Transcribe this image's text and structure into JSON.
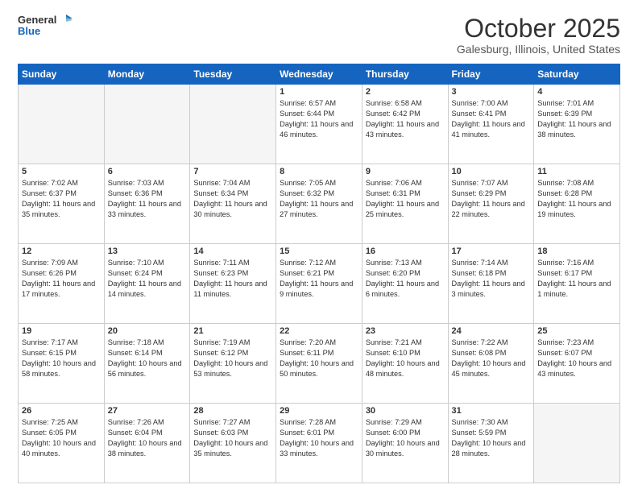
{
  "header": {
    "logo_general": "General",
    "logo_blue": "Blue",
    "title": "October 2025",
    "subtitle": "Galesburg, Illinois, United States"
  },
  "days_of_week": [
    "Sunday",
    "Monday",
    "Tuesday",
    "Wednesday",
    "Thursday",
    "Friday",
    "Saturday"
  ],
  "weeks": [
    [
      {
        "day": "",
        "info": ""
      },
      {
        "day": "",
        "info": ""
      },
      {
        "day": "",
        "info": ""
      },
      {
        "day": "1",
        "info": "Sunrise: 6:57 AM\nSunset: 6:44 PM\nDaylight: 11 hours\nand 46 minutes."
      },
      {
        "day": "2",
        "info": "Sunrise: 6:58 AM\nSunset: 6:42 PM\nDaylight: 11 hours\nand 43 minutes."
      },
      {
        "day": "3",
        "info": "Sunrise: 7:00 AM\nSunset: 6:41 PM\nDaylight: 11 hours\nand 41 minutes."
      },
      {
        "day": "4",
        "info": "Sunrise: 7:01 AM\nSunset: 6:39 PM\nDaylight: 11 hours\nand 38 minutes."
      }
    ],
    [
      {
        "day": "5",
        "info": "Sunrise: 7:02 AM\nSunset: 6:37 PM\nDaylight: 11 hours\nand 35 minutes."
      },
      {
        "day": "6",
        "info": "Sunrise: 7:03 AM\nSunset: 6:36 PM\nDaylight: 11 hours\nand 33 minutes."
      },
      {
        "day": "7",
        "info": "Sunrise: 7:04 AM\nSunset: 6:34 PM\nDaylight: 11 hours\nand 30 minutes."
      },
      {
        "day": "8",
        "info": "Sunrise: 7:05 AM\nSunset: 6:32 PM\nDaylight: 11 hours\nand 27 minutes."
      },
      {
        "day": "9",
        "info": "Sunrise: 7:06 AM\nSunset: 6:31 PM\nDaylight: 11 hours\nand 25 minutes."
      },
      {
        "day": "10",
        "info": "Sunrise: 7:07 AM\nSunset: 6:29 PM\nDaylight: 11 hours\nand 22 minutes."
      },
      {
        "day": "11",
        "info": "Sunrise: 7:08 AM\nSunset: 6:28 PM\nDaylight: 11 hours\nand 19 minutes."
      }
    ],
    [
      {
        "day": "12",
        "info": "Sunrise: 7:09 AM\nSunset: 6:26 PM\nDaylight: 11 hours\nand 17 minutes."
      },
      {
        "day": "13",
        "info": "Sunrise: 7:10 AM\nSunset: 6:24 PM\nDaylight: 11 hours\nand 14 minutes."
      },
      {
        "day": "14",
        "info": "Sunrise: 7:11 AM\nSunset: 6:23 PM\nDaylight: 11 hours\nand 11 minutes."
      },
      {
        "day": "15",
        "info": "Sunrise: 7:12 AM\nSunset: 6:21 PM\nDaylight: 11 hours\nand 9 minutes."
      },
      {
        "day": "16",
        "info": "Sunrise: 7:13 AM\nSunset: 6:20 PM\nDaylight: 11 hours\nand 6 minutes."
      },
      {
        "day": "17",
        "info": "Sunrise: 7:14 AM\nSunset: 6:18 PM\nDaylight: 11 hours\nand 3 minutes."
      },
      {
        "day": "18",
        "info": "Sunrise: 7:16 AM\nSunset: 6:17 PM\nDaylight: 11 hours\nand 1 minute."
      }
    ],
    [
      {
        "day": "19",
        "info": "Sunrise: 7:17 AM\nSunset: 6:15 PM\nDaylight: 10 hours\nand 58 minutes."
      },
      {
        "day": "20",
        "info": "Sunrise: 7:18 AM\nSunset: 6:14 PM\nDaylight: 10 hours\nand 56 minutes."
      },
      {
        "day": "21",
        "info": "Sunrise: 7:19 AM\nSunset: 6:12 PM\nDaylight: 10 hours\nand 53 minutes."
      },
      {
        "day": "22",
        "info": "Sunrise: 7:20 AM\nSunset: 6:11 PM\nDaylight: 10 hours\nand 50 minutes."
      },
      {
        "day": "23",
        "info": "Sunrise: 7:21 AM\nSunset: 6:10 PM\nDaylight: 10 hours\nand 48 minutes."
      },
      {
        "day": "24",
        "info": "Sunrise: 7:22 AM\nSunset: 6:08 PM\nDaylight: 10 hours\nand 45 minutes."
      },
      {
        "day": "25",
        "info": "Sunrise: 7:23 AM\nSunset: 6:07 PM\nDaylight: 10 hours\nand 43 minutes."
      }
    ],
    [
      {
        "day": "26",
        "info": "Sunrise: 7:25 AM\nSunset: 6:05 PM\nDaylight: 10 hours\nand 40 minutes."
      },
      {
        "day": "27",
        "info": "Sunrise: 7:26 AM\nSunset: 6:04 PM\nDaylight: 10 hours\nand 38 minutes."
      },
      {
        "day": "28",
        "info": "Sunrise: 7:27 AM\nSunset: 6:03 PM\nDaylight: 10 hours\nand 35 minutes."
      },
      {
        "day": "29",
        "info": "Sunrise: 7:28 AM\nSunset: 6:01 PM\nDaylight: 10 hours\nand 33 minutes."
      },
      {
        "day": "30",
        "info": "Sunrise: 7:29 AM\nSunset: 6:00 PM\nDaylight: 10 hours\nand 30 minutes."
      },
      {
        "day": "31",
        "info": "Sunrise: 7:30 AM\nSunset: 5:59 PM\nDaylight: 10 hours\nand 28 minutes."
      },
      {
        "day": "",
        "info": ""
      }
    ]
  ]
}
